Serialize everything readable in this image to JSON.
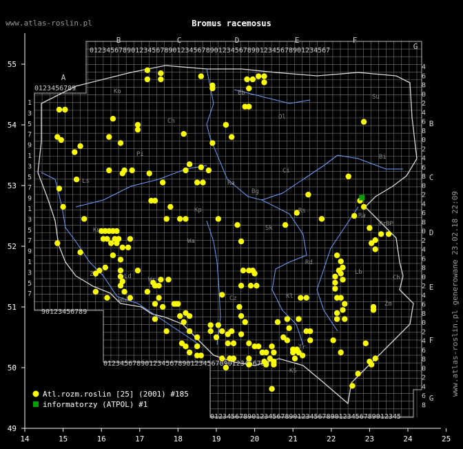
{
  "site": "www.atlas-roslin.pl",
  "title": "Bromus racemosus",
  "generated_note": "www.atlas-roslin.pl generowane 23.02.18 22:09",
  "axes": {
    "x_ticks": [
      "14",
      "15",
      "16",
      "17",
      "18",
      "19",
      "20",
      "21",
      "22",
      "23",
      "24",
      "25"
    ],
    "y_ticks": [
      "49",
      "50",
      "51",
      "52",
      "53",
      "54",
      "55"
    ]
  },
  "grid_letters_top": [
    "A",
    "B",
    "C",
    "D",
    "E",
    "F",
    "G"
  ],
  "grid_letters_right": [
    "B",
    "C",
    "D",
    "E",
    "F",
    "G"
  ],
  "grid_digit_rows": {
    "top_main": "0123456789012345678901234567890123456789012345678901234567",
    "top_a": "0123456789",
    "bottom_left": "90123456789",
    "bottom_mid": "0123456789012345678901234567890123456789",
    "bottom_low": "0123456789012345678901234567890123456789012345"
  },
  "region_codes": [
    "Ko",
    "Eb",
    "Su",
    "Ch",
    "Ol",
    "Bi",
    "Pi",
    "Ci",
    "Ls",
    "Ra",
    "Bg",
    "Kp",
    "Rs",
    "Sk",
    "Ra",
    "Pr",
    "Wa",
    "BP",
    "Kn",
    "Zg",
    "Ld",
    "Lb",
    "Ch",
    "Wb",
    "Wr",
    "Rd",
    "Kl",
    "Zm",
    "Op",
    "Ka",
    "Tr",
    "KS",
    "Cz"
  ],
  "legend": [
    {
      "label": "Atl.rozm.roslin [25] (2001) #185",
      "color": "#ffff00",
      "shape": "circle"
    },
    {
      "label": "informatorzy (ATPOL) #1",
      "color": "#00a000",
      "shape": "square"
    }
  ],
  "colors": {
    "background": "#000000",
    "grid": "#7a7a7a",
    "border": "#dddddd",
    "river": "#6fa0ff",
    "record": "#ffff00",
    "informant": "#00a000"
  },
  "points_lonlat": [
    [
      14.9,
      54.25
    ],
    [
      15.05,
      54.25
    ],
    [
      14.85,
      53.8
    ],
    [
      14.95,
      53.75
    ],
    [
      15.3,
      53.55
    ],
    [
      15.45,
      53.65
    ],
    [
      15.35,
      53.1
    ],
    [
      14.9,
      52.95
    ],
    [
      15.0,
      52.65
    ],
    [
      15.55,
      52.45
    ],
    [
      14.85,
      52.05
    ],
    [
      15.45,
      51.9
    ],
    [
      16.3,
      54.1
    ],
    [
      16.5,
      53.7
    ],
    [
      16.2,
      53.8
    ],
    [
      16.95,
      54.0
    ],
    [
      16.95,
      53.92
    ],
    [
      17.2,
      54.9
    ],
    [
      17.2,
      54.75
    ],
    [
      17.55,
      54.85
    ],
    [
      17.55,
      54.75
    ],
    [
      18.15,
      53.85
    ],
    [
      18.6,
      54.8
    ],
    [
      18.9,
      54.6
    ],
    [
      18.9,
      54.65
    ],
    [
      19.25,
      54.0
    ],
    [
      19.4,
      53.8
    ],
    [
      18.9,
      53.7
    ],
    [
      19.75,
      54.3
    ],
    [
      19.85,
      54.3
    ],
    [
      19.8,
      54.75
    ],
    [
      19.95,
      54.75
    ],
    [
      20.1,
      54.8
    ],
    [
      20.25,
      54.8
    ],
    [
      20.25,
      54.7
    ],
    [
      19.85,
      54.6
    ],
    [
      16.2,
      53.25
    ],
    [
      16.55,
      53.2
    ],
    [
      16.6,
      53.25
    ],
    [
      16.8,
      53.25
    ],
    [
      17.25,
      53.2
    ],
    [
      17.6,
      53.05
    ],
    [
      18.2,
      53.25
    ],
    [
      18.3,
      53.35
    ],
    [
      18.6,
      53.3
    ],
    [
      18.8,
      53.25
    ],
    [
      18.5,
      53.05
    ],
    [
      18.65,
      53.05
    ],
    [
      17.3,
      52.75
    ],
    [
      17.4,
      52.75
    ],
    [
      17.8,
      52.65
    ],
    [
      17.7,
      52.45
    ],
    [
      18.05,
      52.45
    ],
    [
      18.2,
      52.45
    ],
    [
      19.05,
      52.45
    ],
    [
      19.55,
      52.35
    ],
    [
      19.65,
      52.08
    ],
    [
      20.8,
      52.35
    ],
    [
      21.1,
      52.55
    ],
    [
      21.75,
      52.45
    ],
    [
      21.4,
      52.85
    ],
    [
      22.45,
      53.15
    ],
    [
      22.75,
      52.75
    ],
    [
      22.85,
      52.65
    ],
    [
      22.6,
      52.5
    ],
    [
      23.0,
      52.3
    ],
    [
      23.15,
      52.1
    ],
    [
      23.05,
      52.05
    ],
    [
      23.15,
      51.95
    ],
    [
      23.3,
      52.2
    ],
    [
      23.5,
      52.2
    ],
    [
      22.85,
      54.05
    ],
    [
      16.0,
      52.25
    ],
    [
      16.1,
      52.25
    ],
    [
      16.2,
      52.25
    ],
    [
      16.3,
      52.25
    ],
    [
      16.4,
      52.25
    ],
    [
      16.05,
      52.12
    ],
    [
      16.15,
      52.12
    ],
    [
      16.35,
      52.12
    ],
    [
      16.45,
      52.12
    ],
    [
      16.25,
      52.05
    ],
    [
      16.4,
      52.05
    ],
    [
      16.55,
      51.98
    ],
    [
      16.7,
      51.98
    ],
    [
      16.75,
      52.12
    ],
    [
      16.3,
      51.85
    ],
    [
      16.5,
      51.78
    ],
    [
      16.5,
      51.6
    ],
    [
      16.5,
      51.5
    ],
    [
      16.55,
      51.42
    ],
    [
      16.5,
      51.35
    ],
    [
      16.6,
      51.25
    ],
    [
      16.75,
      51.15
    ],
    [
      15.95,
      51.6
    ],
    [
      16.1,
      51.65
    ],
    [
      15.85,
      51.55
    ],
    [
      15.85,
      51.25
    ],
    [
      16.15,
      51.15
    ],
    [
      16.95,
      51.6
    ],
    [
      17.2,
      51.25
    ],
    [
      17.35,
      51.4
    ],
    [
      17.4,
      51.35
    ],
    [
      17.5,
      51.35
    ],
    [
      17.55,
      51.45
    ],
    [
      17.4,
      51.05
    ],
    [
      17.5,
      51.15
    ],
    [
      17.6,
      51.0
    ],
    [
      17.75,
      51.45
    ],
    [
      17.9,
      51.05
    ],
    [
      17.95,
      51.05
    ],
    [
      17.7,
      50.6
    ],
    [
      18.0,
      51.05
    ],
    [
      18.05,
      50.85
    ],
    [
      18.15,
      50.75
    ],
    [
      18.2,
      50.9
    ],
    [
      18.3,
      50.85
    ],
    [
      18.3,
      50.6
    ],
    [
      18.5,
      50.5
    ],
    [
      18.5,
      50.35
    ],
    [
      18.6,
      50.2
    ],
    [
      18.5,
      50.2
    ],
    [
      18.1,
      50.4
    ],
    [
      18.2,
      50.35
    ],
    [
      18.3,
      50.25
    ],
    [
      18.85,
      50.6
    ],
    [
      18.85,
      50.7
    ],
    [
      19.05,
      50.7
    ],
    [
      19.15,
      50.6
    ],
    [
      19.0,
      50.5
    ],
    [
      19.25,
      50.0
    ],
    [
      19.3,
      50.4
    ],
    [
      19.45,
      50.4
    ],
    [
      19.3,
      50.55
    ],
    [
      19.4,
      50.6
    ],
    [
      19.65,
      50.55
    ],
    [
      19.75,
      50.75
    ],
    [
      19.65,
      50.85
    ],
    [
      19.6,
      51.0
    ],
    [
      19.15,
      51.2
    ],
    [
      19.65,
      51.35
    ],
    [
      19.7,
      51.6
    ],
    [
      19.85,
      51.6
    ],
    [
      19.95,
      51.6
    ],
    [
      19.9,
      51.35
    ],
    [
      20.05,
      51.35
    ],
    [
      20.0,
      51.55
    ],
    [
      19.85,
      50.4
    ],
    [
      20.0,
      50.35
    ],
    [
      20.1,
      50.35
    ],
    [
      20.2,
      50.25
    ],
    [
      20.3,
      50.25
    ],
    [
      20.45,
      50.35
    ],
    [
      20.5,
      50.25
    ],
    [
      20.5,
      50.1
    ],
    [
      20.5,
      50.05
    ],
    [
      20.3,
      50.05
    ],
    [
      20.25,
      50.1
    ],
    [
      20.4,
      50.15
    ],
    [
      19.85,
      50.05
    ],
    [
      19.85,
      50.15
    ],
    [
      19.15,
      50.15
    ],
    [
      19.35,
      50.15
    ],
    [
      19.45,
      50.15
    ],
    [
      20.6,
      50.75
    ],
    [
      20.9,
      50.65
    ],
    [
      20.85,
      50.8
    ],
    [
      21.15,
      50.8
    ],
    [
      21.35,
      50.6
    ],
    [
      21.45,
      50.6
    ],
    [
      21.2,
      51.15
    ],
    [
      21.35,
      51.15
    ],
    [
      21.0,
      50.3
    ],
    [
      21.05,
      50.15
    ],
    [
      21.0,
      50.25
    ],
    [
      21.1,
      50.3
    ],
    [
      21.15,
      50.25
    ],
    [
      21.25,
      50.2
    ],
    [
      21.45,
      50.45
    ],
    [
      20.75,
      50.5
    ],
    [
      20.85,
      50.45
    ],
    [
      22.05,
      50.45
    ],
    [
      22.25,
      51.15
    ],
    [
      22.35,
      51.05
    ],
    [
      22.3,
      50.95
    ],
    [
      22.35,
      50.8
    ],
    [
      22.15,
      50.8
    ],
    [
      22.15,
      50.9
    ],
    [
      22.15,
      51.15
    ],
    [
      22.1,
      51.3
    ],
    [
      22.1,
      51.4
    ],
    [
      22.1,
      51.5
    ],
    [
      22.2,
      51.6
    ],
    [
      22.3,
      51.65
    ],
    [
      22.3,
      51.45
    ],
    [
      22.25,
      51.55
    ],
    [
      22.25,
      51.75
    ],
    [
      22.15,
      51.85
    ],
    [
      22.25,
      50.25
    ],
    [
      22.55,
      49.7
    ],
    [
      22.7,
      49.9
    ],
    [
      22.9,
      50.4
    ],
    [
      23.0,
      50.1
    ],
    [
      23.15,
      50.15
    ],
    [
      23.05,
      50.05
    ],
    [
      23.1,
      50.95
    ],
    [
      23.1,
      51.0
    ],
    [
      20.45,
      49.65
    ],
    [
      17.4,
      50.8
    ]
  ],
  "informant_points": [
    [
      22.8,
      52.8
    ]
  ]
}
